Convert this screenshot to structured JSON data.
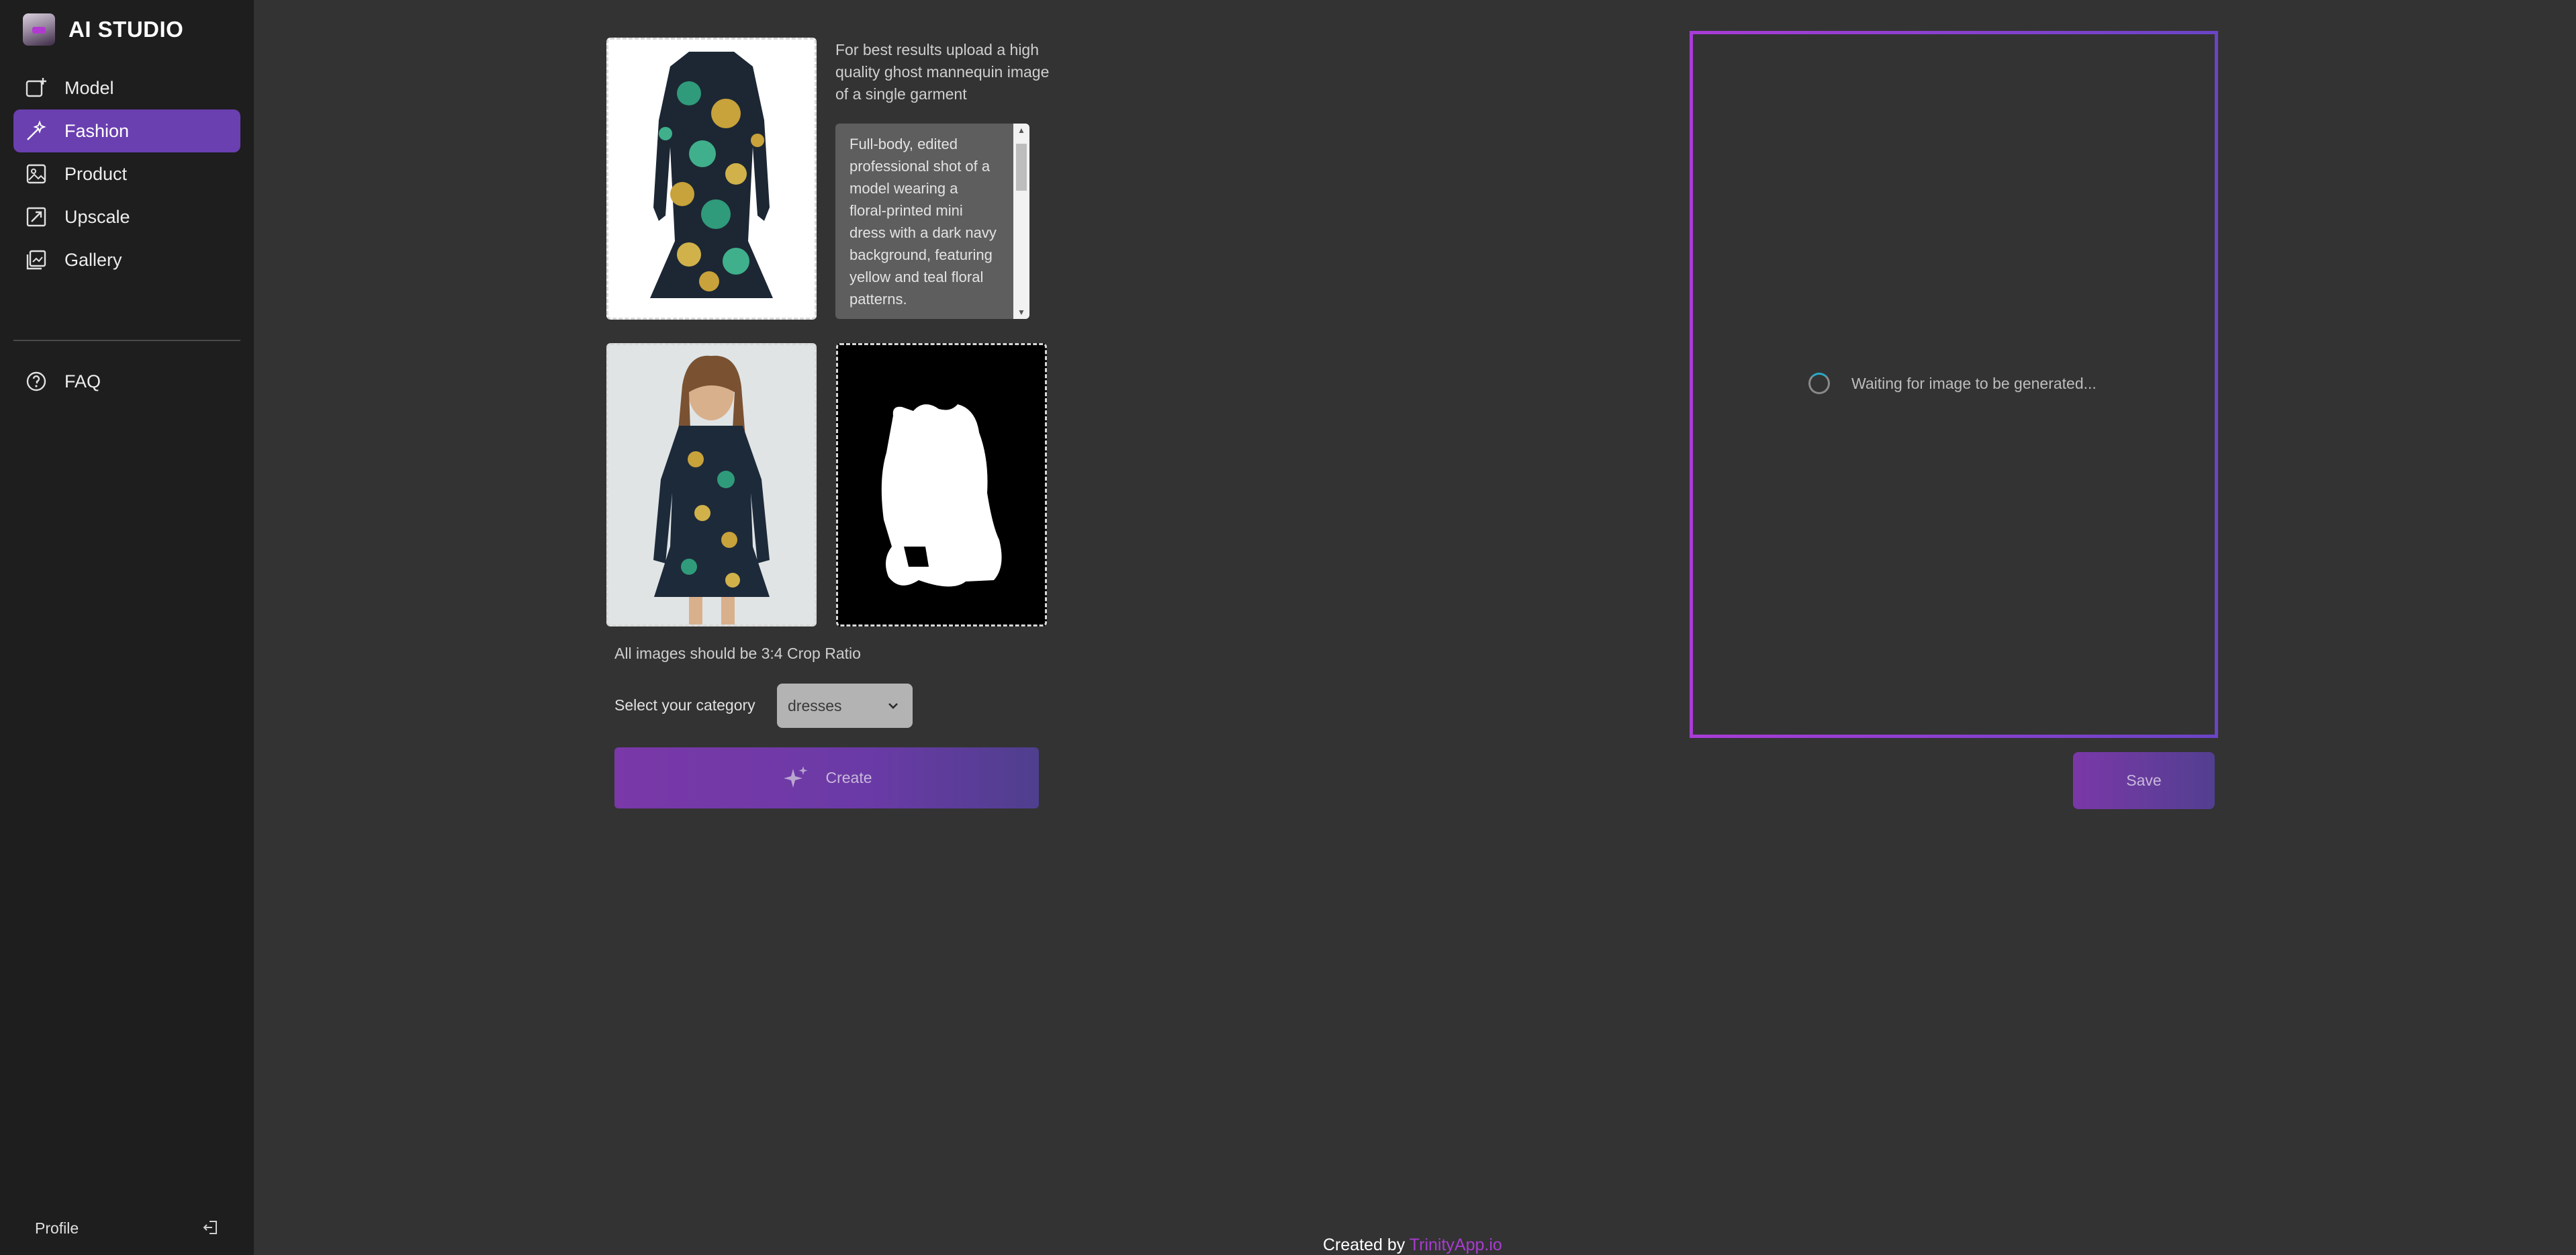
{
  "app": {
    "title": "AI STUDIO"
  },
  "sidebar": {
    "items": [
      {
        "label": "Model",
        "icon": "add-image-icon"
      },
      {
        "label": "Fashion",
        "icon": "magic-wand-icon",
        "active": true
      },
      {
        "label": "Product",
        "icon": "product-icon"
      },
      {
        "label": "Upscale",
        "icon": "upscale-icon"
      },
      {
        "label": "Gallery",
        "icon": "gallery-icon"
      }
    ],
    "faq": {
      "label": "FAQ",
      "icon": "question-icon"
    },
    "profile_label": "Profile"
  },
  "main": {
    "hint": "For best results upload a high quality ghost mannequin image of a single garment",
    "description": "Full-body, edited professional shot of a model wearing a floral-printed mini dress with a dark navy background, featuring yellow and teal floral patterns.",
    "crop_note": "All images should be 3:4 Crop Ratio",
    "category_label": "Select your category",
    "category_value": "dresses",
    "create_label": "Create"
  },
  "preview": {
    "waiting_text": "Waiting for image to be generated...",
    "save_label": "Save"
  },
  "footer": {
    "prefix": "Created by",
    "link": "TrinityApp.io"
  },
  "colors": {
    "accent": "#6a3fb0",
    "border_gradient_start": "#a93cd6",
    "border_gradient_end": "#6a44c6",
    "link": "#a83cd0"
  }
}
